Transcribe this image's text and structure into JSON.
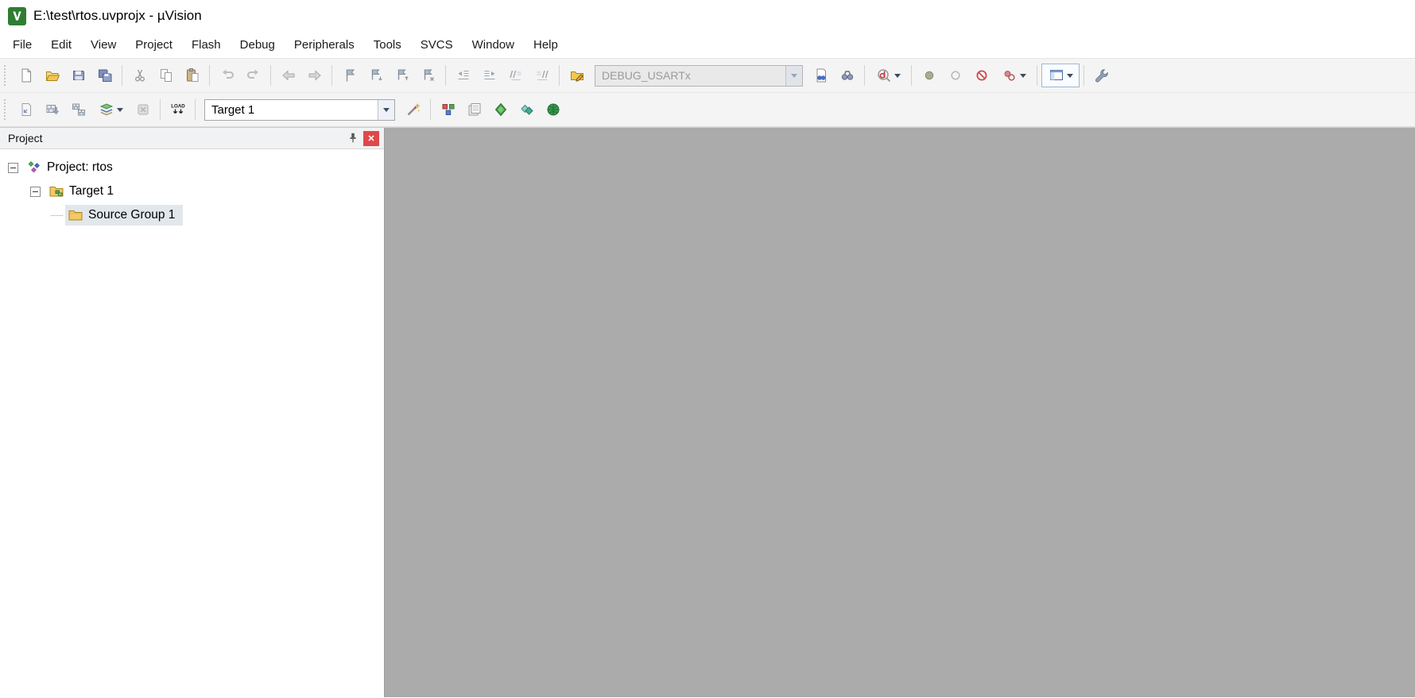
{
  "titlebar": {
    "title": "E:\\test\\rtos.uvprojx - µVision"
  },
  "menubar": {
    "items": [
      "File",
      "Edit",
      "View",
      "Project",
      "Flash",
      "Debug",
      "Peripherals",
      "Tools",
      "SVCS",
      "Window",
      "Help"
    ]
  },
  "toolbar_main": {
    "buttons": [
      "new-file",
      "open-file",
      "save",
      "save-all",
      "cut",
      "copy",
      "paste",
      "undo",
      "redo",
      "navigate-back",
      "navigate-forward",
      "toggle-bookmark",
      "next-bookmark",
      "previous-bookmark",
      "clear-bookmarks",
      "indent-left",
      "indent-right",
      "comment-selection",
      "uncomment-selection",
      "find-in-files-dialog",
      "find-in-files",
      "incremental-find",
      "start-stop-debug-session",
      "toggle-breakpoint",
      "enable-disable-breakpoint",
      "kill-all-breakpoints",
      "disable-all-breakpoints",
      "window-layout",
      "configuration-wrench"
    ],
    "find_combo": {
      "value": "DEBUG_USARTx",
      "disabled": true
    }
  },
  "toolbar_build": {
    "buttons": [
      "translate",
      "build",
      "rebuild-all",
      "batch-build",
      "stop-build",
      "download-to-flash",
      "options-for-target",
      "manage-project-items",
      "file-extensions-books",
      "manage-run-time-environment",
      "select-software-packs",
      "pack-installer"
    ],
    "download_label": "LOAD",
    "target_combo": {
      "value": "Target 1"
    }
  },
  "project_panel": {
    "title": "Project",
    "tree": [
      {
        "label": "Project: rtos",
        "icon": "project",
        "level": 0,
        "expanded": true,
        "selected": false
      },
      {
        "label": "Target 1",
        "icon": "target",
        "level": 1,
        "expanded": true,
        "selected": false
      },
      {
        "label": "Source Group 1",
        "icon": "folder",
        "level": 2,
        "expanded": false,
        "selected": true
      }
    ]
  },
  "main_area": {
    "content": ""
  },
  "colors": {
    "main_area": "#ababab",
    "selection": "#e2e7ec",
    "close_button": "#e04848",
    "toolbar_bg": "#f4f4f4",
    "logo_green": "#2e7d32",
    "folder_yellow": "#f5c863"
  }
}
